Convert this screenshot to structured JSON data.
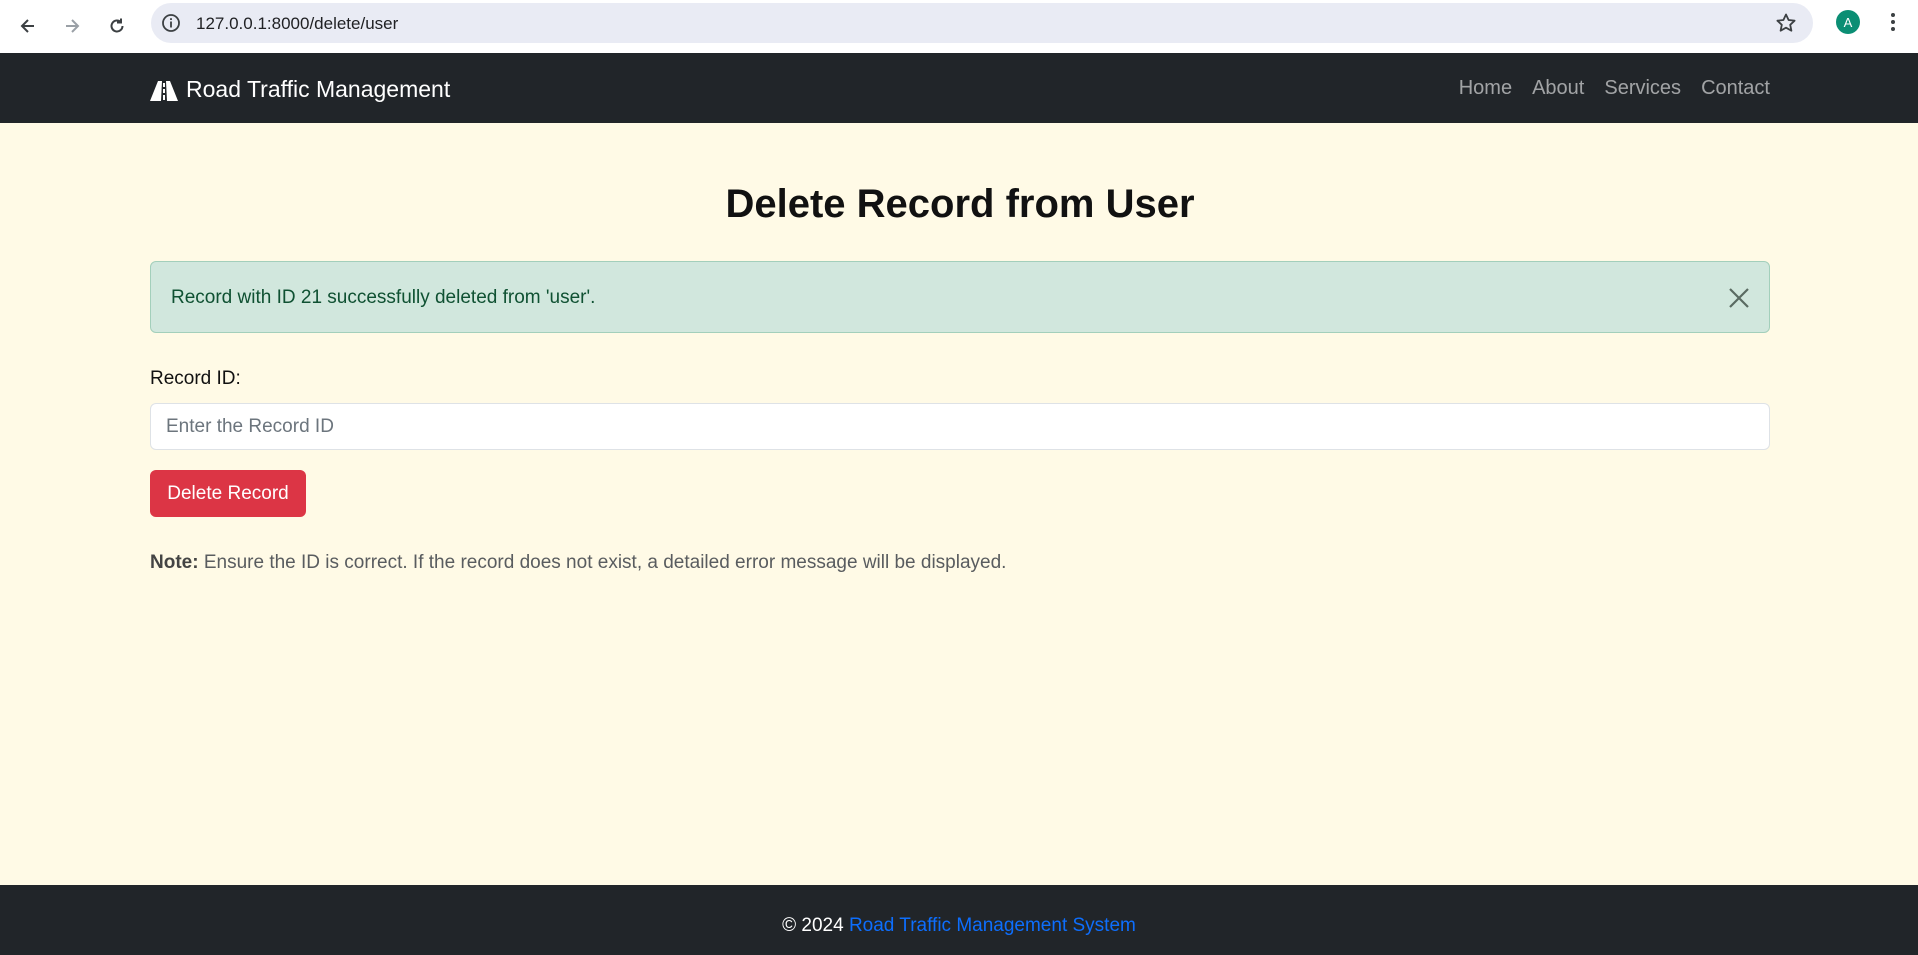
{
  "browser": {
    "url": "127.0.0.1:8000/delete/user",
    "profile_initial": "A"
  },
  "navbar": {
    "brand": "Road Traffic Management",
    "links": [
      "Home",
      "About",
      "Services",
      "Contact"
    ]
  },
  "main": {
    "title": "Delete Record from User",
    "alert_message": "Record with ID 21 successfully deleted from 'user'.",
    "record_id_label": "Record ID:",
    "record_id_placeholder": "Enter the Record ID",
    "delete_button_label": "Delete Record",
    "note_prefix": "Note:",
    "note_text": "Ensure the ID is correct. If the record does not exist, a detailed error message will be displayed."
  },
  "footer": {
    "copyright": "© 2024",
    "link_text": "Road Traffic Management System"
  },
  "colors": {
    "navbar_bg": "#212529",
    "page_bg": "#fffae6",
    "alert_bg": "#d1e7dd",
    "danger": "#dc3545",
    "link": "#0d6efd"
  }
}
